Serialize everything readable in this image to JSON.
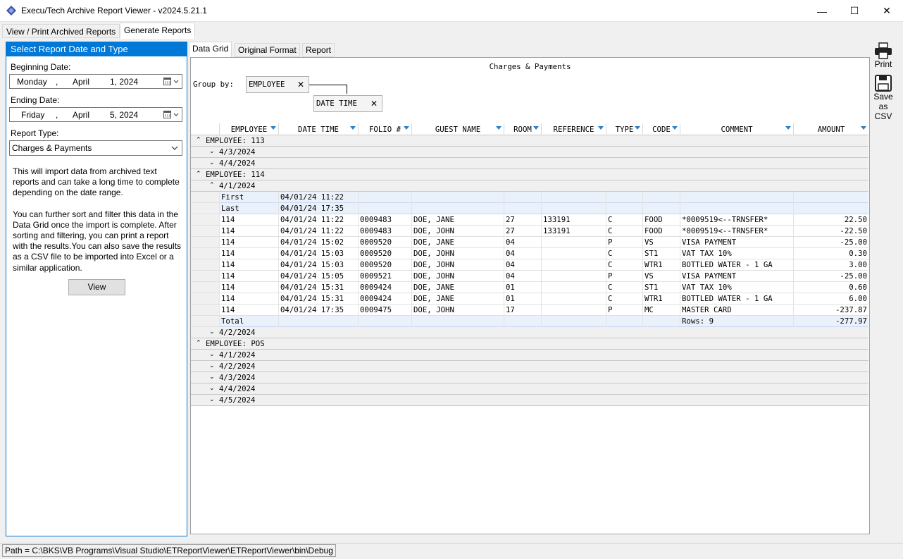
{
  "window": {
    "title": "Execu/Tech Archive Report Viewer - v2024.5.21.1",
    "min": "—",
    "max": "☐",
    "close": "✕"
  },
  "top_tabs": [
    "View / Print Archived Reports",
    "Generate Reports"
  ],
  "left": {
    "header": "Select Report Date and Type",
    "begin_label": "Beginning Date:",
    "begin": {
      "weekday": "Monday",
      "sep": ",",
      "month": "April",
      "day": "1, 2024"
    },
    "end_label": "Ending Date:",
    "end": {
      "weekday": "Friday",
      "sep": ",",
      "month": "April",
      "day": "5, 2024"
    },
    "type_label": "Report Type:",
    "type_value": "Charges & Payments",
    "desc1": "This will import data from archived text reports and can take a long time to complete depending on the date range.",
    "desc2": "You can further sort and filter this data in the Data Grid once the import is complete. After sorting and filtering, you can print a report with the results.You can also save the results as a CSV file to be imported into Excel or a similar application.",
    "view_button": "View"
  },
  "toolbar": {
    "print": "Print",
    "save1": "Save",
    "save2": "as",
    "save3": "CSV"
  },
  "inner_tabs": [
    "Data Grid",
    "Original Format",
    "Report"
  ],
  "grid": {
    "title": "Charges & Payments",
    "group_by_label": "Group by:",
    "group_chips": [
      "EMPLOYEE",
      "DATE TIME"
    ],
    "columns": [
      "EMPLOYEE",
      "DATE TIME",
      "FOLIO #",
      "GUEST NAME",
      "ROOM",
      "REFERENCE",
      "TYPE",
      "CODE",
      "COMMENT",
      "AMOUNT"
    ],
    "groups": {
      "g113": "EMPLOYEE: 113",
      "g113_dates": [
        "4/3/2024",
        "4/4/2024"
      ],
      "g114": "EMPLOYEE: 114",
      "g114_open": "4/1/2024",
      "first": [
        "First",
        "04/01/24 11:22"
      ],
      "last": [
        "Last",
        "04/01/24 17:35"
      ],
      "rows": [
        [
          "114",
          "04/01/24 11:22",
          "0009483",
          "DOE, JANE",
          "27",
          "133191",
          "C",
          "FOOD",
          "*0009519<--TRNSFER*",
          "22.50"
        ],
        [
          "114",
          "04/01/24 11:22",
          "0009483",
          "DOE, JOHN",
          "27",
          "133191",
          "C",
          "FOOD",
          "*0009519<--TRNSFER*",
          "-22.50"
        ],
        [
          "114",
          "04/01/24 15:02",
          "0009520",
          "DOE, JANE",
          "04",
          "",
          "P",
          "VS",
          "VISA PAYMENT",
          "-25.00"
        ],
        [
          "114",
          "04/01/24 15:03",
          "0009520",
          "DOE, JOHN",
          "04",
          "",
          "C",
          "ST1",
          "VAT TAX 10%",
          "0.30"
        ],
        [
          "114",
          "04/01/24 15:03",
          "0009520",
          "DOE, JOHN",
          "04",
          "",
          "C",
          "WTR1",
          "BOTTLED WATER - 1 GA",
          "3.00"
        ],
        [
          "114",
          "04/01/24 15:05",
          "0009521",
          "DOE, JOHN",
          "04",
          "",
          "P",
          "VS",
          "VISA PAYMENT",
          "-25.00"
        ],
        [
          "114",
          "04/01/24 15:31",
          "0009424",
          "DOE, JANE",
          "01",
          "",
          "C",
          "ST1",
          "VAT TAX 10%",
          "0.60"
        ],
        [
          "114",
          "04/01/24 15:31",
          "0009424",
          "DOE, JANE",
          "01",
          "",
          "C",
          "WTR1",
          "BOTTLED WATER - 1 GA",
          "6.00"
        ],
        [
          "114",
          "04/01/24 17:35",
          "0009475",
          "DOE, JOHN",
          "17",
          "",
          "P",
          "MC",
          "MASTER CARD",
          "-237.87"
        ]
      ],
      "total": [
        "Total",
        "Rows: 9",
        "-277.97"
      ],
      "g114_after": "4/2/2024",
      "gpos": "EMPLOYEE: POS",
      "gpos_dates": [
        "4/1/2024",
        "4/2/2024",
        "4/3/2024",
        "4/4/2024",
        "4/5/2024"
      ]
    }
  },
  "status": {
    "path": "Path = C:\\BKS\\VB Programs\\Visual Studio\\ETReportViewer\\ETReportViewer\\bin\\Debug"
  },
  "colors": {
    "accent": "#0078d7",
    "summary": "#eaf1fb",
    "funnel": "#2f7ec4"
  }
}
